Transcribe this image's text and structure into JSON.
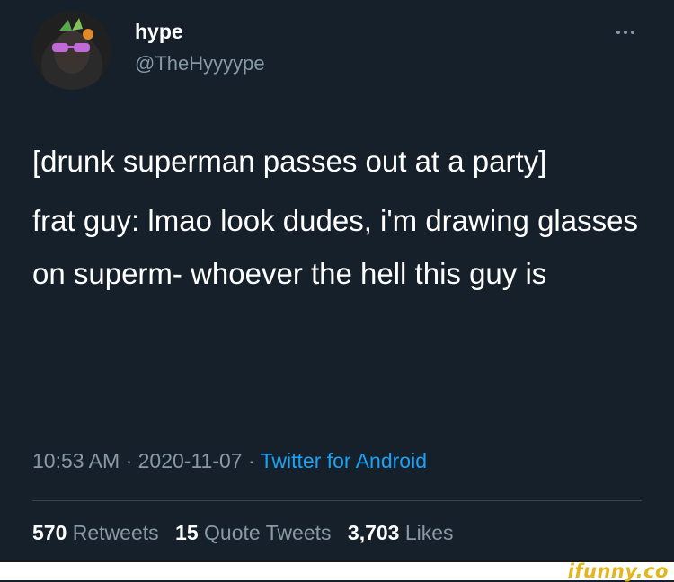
{
  "tweet": {
    "author": {
      "display_name": "hype",
      "handle": "@TheHyyyype",
      "avatar_icon": "avatar-icon"
    },
    "more_icon": "more-icon",
    "text": [
      "[drunk superman passes out at a party]",
      "frat guy: lmao look dudes, i'm drawing glasses on superm- whoever the hell this guy is"
    ],
    "time": "10:53 AM",
    "date": "2020-11-07",
    "separator": " · ",
    "source": "Twitter for Android",
    "stats": {
      "retweets_count": "570",
      "retweets_label": "Retweets",
      "quotes_count": "15",
      "quotes_label": "Quote Tweets",
      "likes_count": "3,703",
      "likes_label": "Likes"
    }
  },
  "watermark": {
    "text": "ifunny.co"
  },
  "colors": {
    "background": "#15202b",
    "secondary_text": "#8899a6",
    "link": "#1da1f2",
    "watermark": "#e5b51e"
  }
}
